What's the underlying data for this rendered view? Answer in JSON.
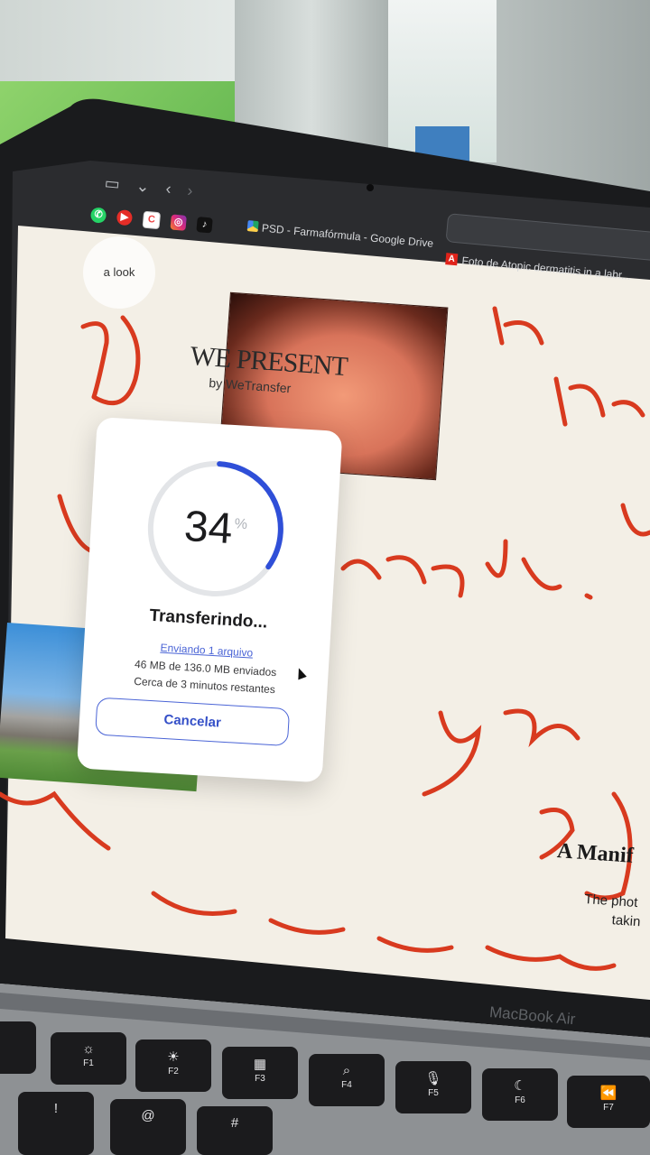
{
  "browser": {
    "tabs": [
      {
        "label": "PSD - Farmafórmula - Google Drive",
        "icon": "google-drive-icon"
      },
      {
        "label": "Foto de Atopic dermatitis in a labr...",
        "icon": "adobe-icon"
      }
    ],
    "favorites": [
      "whatsapp-icon",
      "youtube-icon",
      "canva-icon",
      "instagram-icon",
      "tiktok-icon"
    ]
  },
  "page": {
    "look_chip": "a look",
    "brand_title": "WE PRESENT",
    "brand_by": "by WeTransfer",
    "manifesto_title": "A Manif",
    "manifesto_line1": "The phot",
    "manifesto_line2": "takin",
    "handwriting": [
      "vered.",
      "you",
      "3)"
    ]
  },
  "transfer": {
    "percent": 34,
    "percent_text": "34",
    "percent_sign": "%",
    "title": "Transferindo...",
    "sending_link": "Enviando 1 arquivo",
    "progress_detail": "46 MB de 136.0 MB enviados",
    "time_remaining": "Cerca de 3 minutos restantes",
    "cancel_label": "Cancelar",
    "accent_color": "#2f4fd8",
    "track_color": "#e3e5e8"
  },
  "laptop": {
    "model": "MacBook Air"
  },
  "keyboard": {
    "keys": [
      {
        "glyph": "☼",
        "label": "F1"
      },
      {
        "glyph": "☀",
        "label": "F2"
      },
      {
        "glyph": "▦",
        "label": "F3"
      },
      {
        "glyph": "⌕",
        "label": "F4"
      },
      {
        "glyph": "🎙",
        "label": "F5"
      },
      {
        "glyph": "☾",
        "label": "F6"
      },
      {
        "glyph": "⏪",
        "label": "F7"
      }
    ],
    "number_keys": [
      "!",
      "@",
      "#"
    ]
  }
}
